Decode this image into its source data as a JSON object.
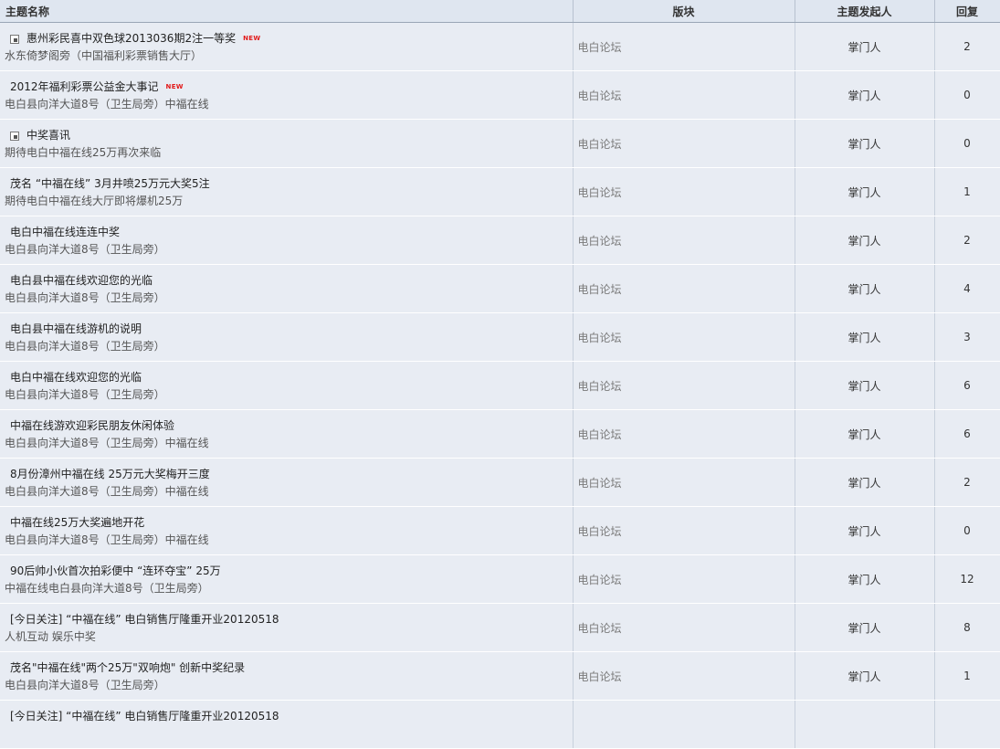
{
  "header": {
    "title_col": "主题名称",
    "board_col": "版块",
    "author_col": "主题发起人",
    "replies_col": "回复"
  },
  "rows": [
    {
      "title": "惠州彩民喜中双色球2013036期2注一等奖",
      "sub": "水东倚梦阁旁（中国福利彩票销售大厅）",
      "board": "电白论坛",
      "author": "掌门人",
      "replies": "2",
      "icon": true,
      "new": "NEW"
    },
    {
      "title": "2012年福利彩票公益金大事记",
      "sub": "电白县向洋大道8号（卫生局旁）中福在线",
      "board": "电白论坛",
      "author": "掌门人",
      "replies": "0",
      "icon": false,
      "new": "NEW"
    },
    {
      "title": "中奖喜讯",
      "sub": "期待电白中福在线25万再次来临",
      "board": "电白论坛",
      "author": "掌门人",
      "replies": "0",
      "icon": true,
      "new": ""
    },
    {
      "title": "茂名 “中福在线” 3月井喷25万元大奖5注",
      "sub": "期待电白中福在线大厅即将爆机25万",
      "board": "电白论坛",
      "author": "掌门人",
      "replies": "1",
      "icon": false,
      "new": ""
    },
    {
      "title": "电白中福在线连连中奖",
      "sub": "电白县向洋大道8号（卫生局旁）",
      "board": "电白论坛",
      "author": "掌门人",
      "replies": "2",
      "icon": false,
      "new": ""
    },
    {
      "title": "电白县中福在线欢迎您的光临",
      "sub": "电白县向洋大道8号（卫生局旁）",
      "board": "电白论坛",
      "author": "掌门人",
      "replies": "4",
      "icon": false,
      "new": ""
    },
    {
      "title": "电白县中福在线游机的说明",
      "sub": "电白县向洋大道8号（卫生局旁）",
      "board": "电白论坛",
      "author": "掌门人",
      "replies": "3",
      "icon": false,
      "new": ""
    },
    {
      "title": "电白中福在线欢迎您的光临",
      "sub": "电白县向洋大道8号（卫生局旁）",
      "board": "电白论坛",
      "author": "掌门人",
      "replies": "6",
      "icon": false,
      "new": ""
    },
    {
      "title": "中福在线游欢迎彩民朋友休闲体验",
      "sub": "电白县向洋大道8号（卫生局旁）中福在线",
      "board": "电白论坛",
      "author": "掌门人",
      "replies": "6",
      "icon": false,
      "new": ""
    },
    {
      "title": "8月份漳州中福在线 25万元大奖梅开三度",
      "sub": "电白县向洋大道8号（卫生局旁）中福在线",
      "board": "电白论坛",
      "author": "掌门人",
      "replies": "2",
      "icon": false,
      "new": ""
    },
    {
      "title": "中福在线25万大奖遍地开花",
      "sub": "电白县向洋大道8号（卫生局旁）中福在线",
      "board": "电白论坛",
      "author": "掌门人",
      "replies": "0",
      "icon": false,
      "new": ""
    },
    {
      "title": "90后帅小伙首次拍彩便中 “连环夺宝” 25万",
      "sub": "中福在线电白县向洋大道8号（卫生局旁）",
      "board": "电白论坛",
      "author": "掌门人",
      "replies": "12",
      "icon": false,
      "new": ""
    },
    {
      "title": "[今日关注] “中福在线” 电白销售厅隆重开业20120518",
      "sub": "人机互动 娱乐中奖",
      "board": "电白论坛",
      "author": "掌门人",
      "replies": "8",
      "icon": false,
      "new": ""
    },
    {
      "title": "茂名\"中福在线\"两个25万\"双响炮\" 创新中奖纪录",
      "sub": "电白县向洋大道8号（卫生局旁）",
      "board": "电白论坛",
      "author": "掌门人",
      "replies": "1",
      "icon": false,
      "new": ""
    },
    {
      "title": "[今日关注] “中福在线” 电白销售厅隆重开业20120518",
      "sub": "",
      "board": "",
      "author": "",
      "replies": "",
      "icon": false,
      "new": ""
    }
  ]
}
